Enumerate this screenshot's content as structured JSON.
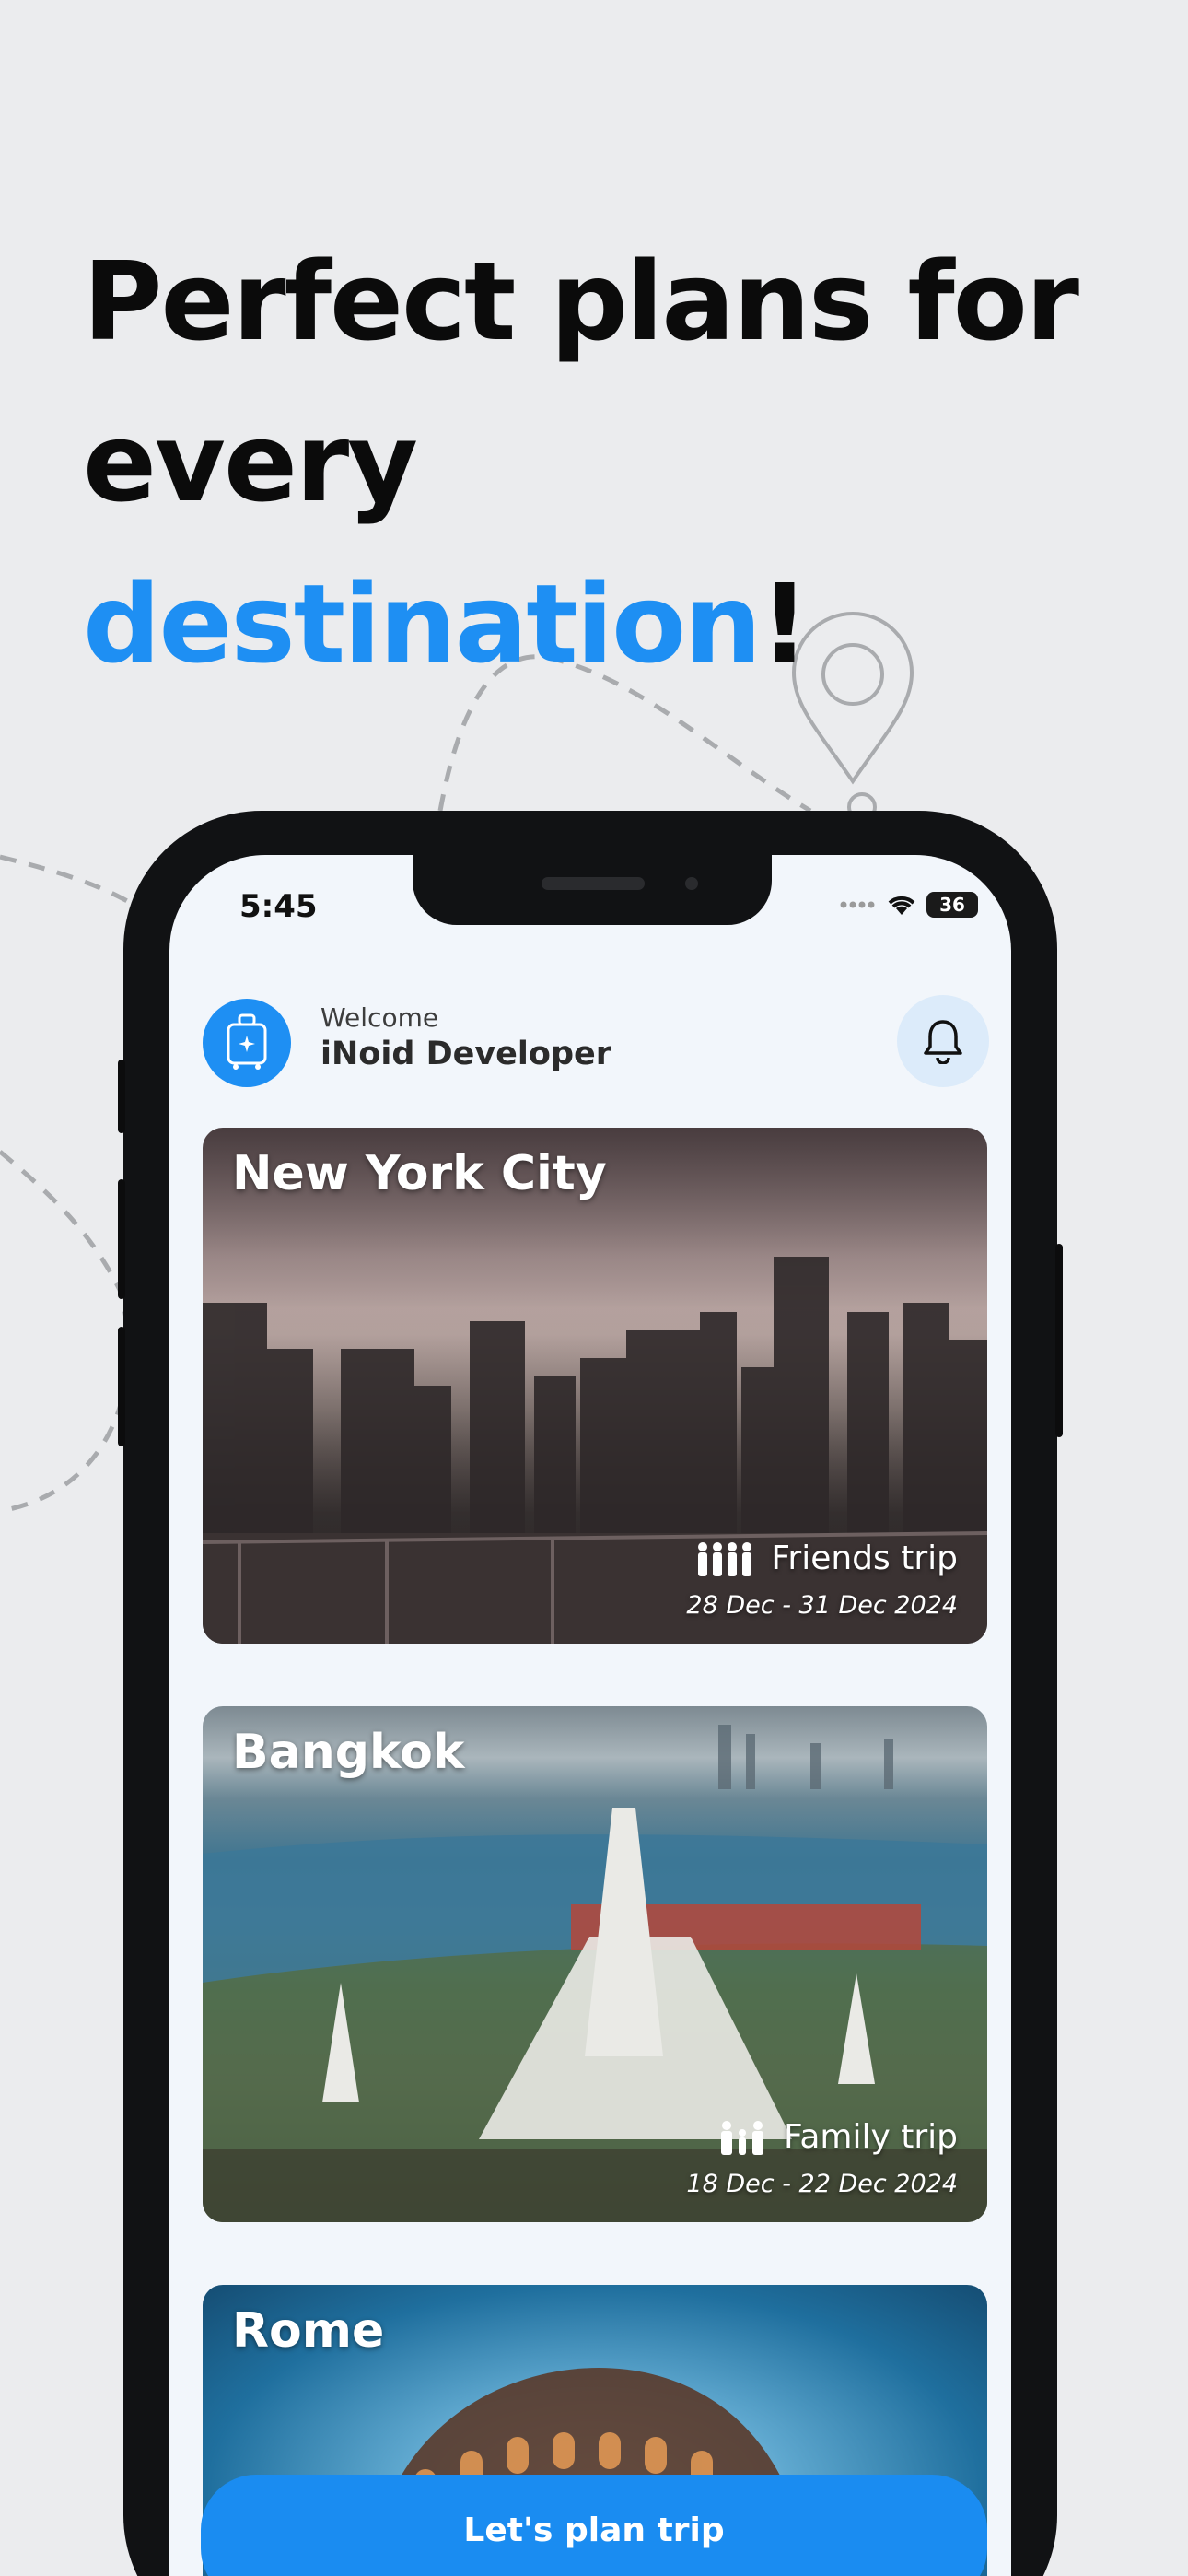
{
  "headline": {
    "line1": "Perfect plans for",
    "line2_prefix": "every ",
    "line2_accent": "destination",
    "line2_suffix": "!",
    "accent_color": "#1e8ff3"
  },
  "status_bar": {
    "time": "5:45",
    "battery": "36",
    "icons": [
      "signal-dots-icon",
      "wifi-icon",
      "battery-icon"
    ]
  },
  "header": {
    "welcome": "Welcome",
    "user_name": "iNoid Developer",
    "logo_icon": "suitcase-sparkle-icon",
    "notification_icon": "bell-icon"
  },
  "trips": [
    {
      "title": "New York City",
      "type": "Friends trip",
      "type_icon": "group-people-icon",
      "dates": "28 Dec - 31 Dec 2024"
    },
    {
      "title": "Bangkok",
      "type": "Family trip",
      "type_icon": "family-icon",
      "dates": "18 Dec - 22 Dec 2024"
    },
    {
      "title": "Rome"
    }
  ],
  "cta": {
    "label": "Let's plan trip",
    "color": "#1a8cf1"
  }
}
